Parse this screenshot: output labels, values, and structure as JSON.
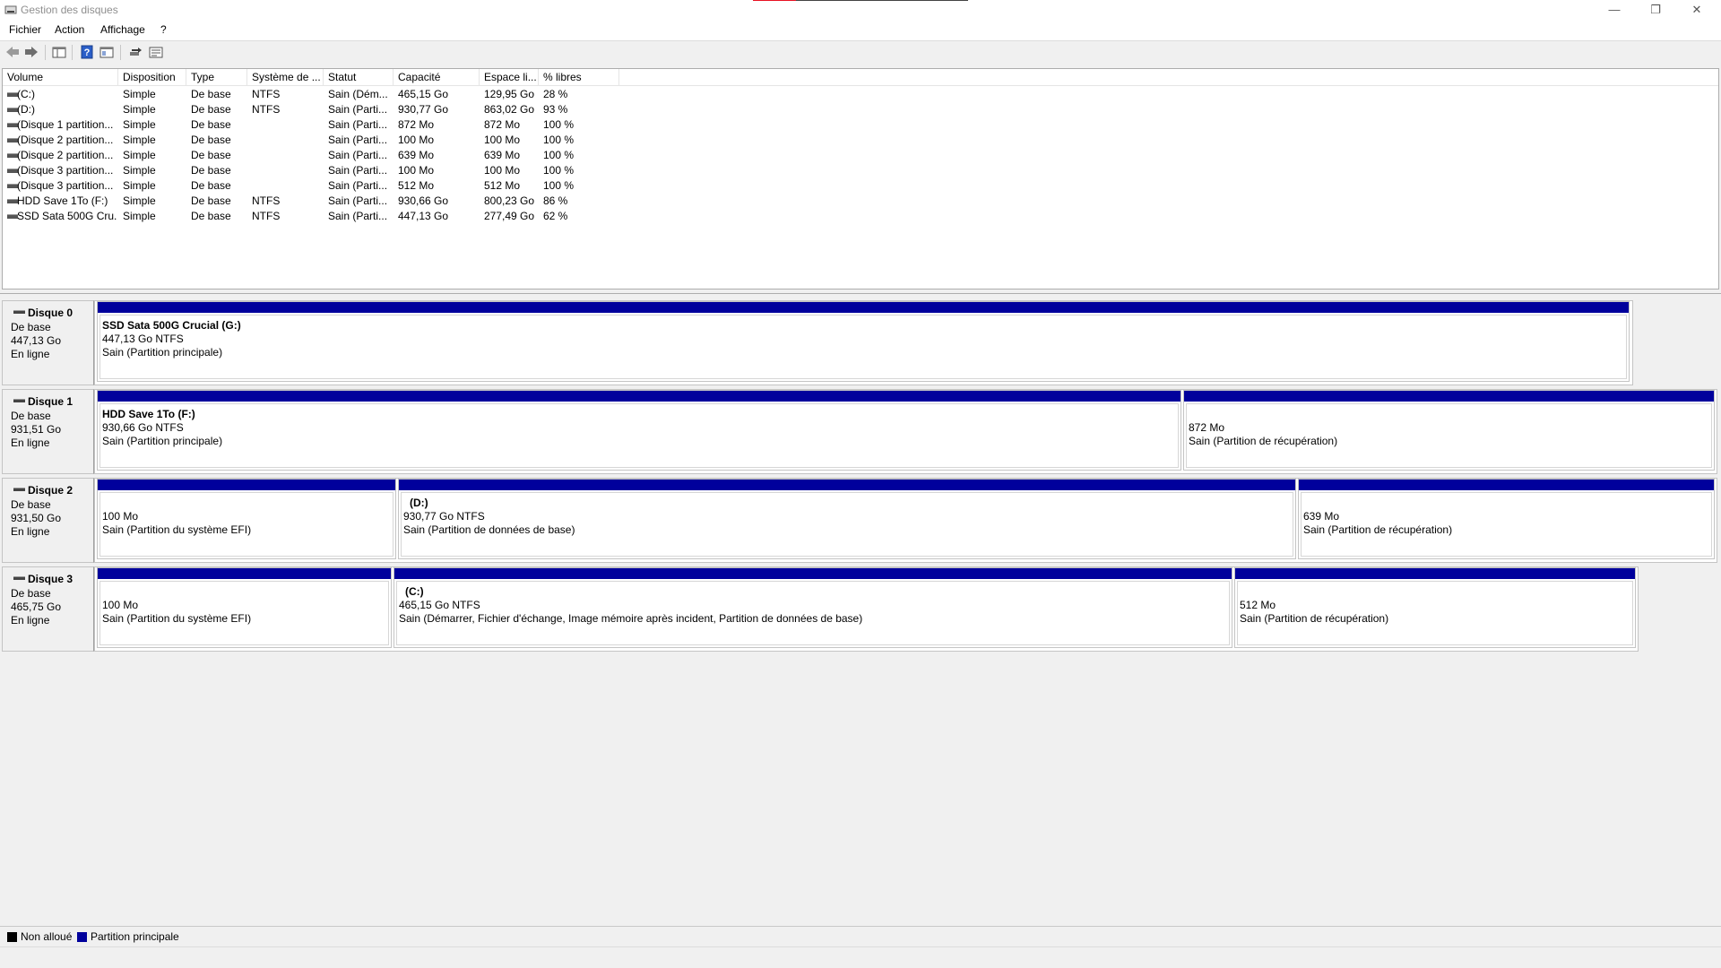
{
  "window": {
    "title": "Gestion des disques",
    "minimize": "—",
    "restore": "❐",
    "close": "✕"
  },
  "menu": [
    "Fichier",
    "Action",
    "Affichage",
    "?"
  ],
  "toolbar": [
    "back-arrow-icon",
    "forward-arrow-icon",
    "console-tree-icon",
    "help-icon",
    "properties-icon",
    "refresh-icon",
    "settings-icon"
  ],
  "volume_list": {
    "columns": [
      "Volume",
      "Disposition",
      "Type",
      "Système de ...",
      "Statut",
      "Capacité",
      "Espace li...",
      "% libres"
    ],
    "rows": [
      [
        "(C:)",
        "Simple",
        "De base",
        "NTFS",
        "Sain (Dém...",
        "465,15 Go",
        "129,95 Go",
        "28 %"
      ],
      [
        "(D:)",
        "Simple",
        "De base",
        "NTFS",
        "Sain (Parti...",
        "930,77 Go",
        "863,02 Go",
        "93 %"
      ],
      [
        "(Disque 1 partition...",
        "Simple",
        "De base",
        "",
        "Sain (Parti...",
        "872 Mo",
        "872 Mo",
        "100 %"
      ],
      [
        "(Disque 2 partition...",
        "Simple",
        "De base",
        "",
        "Sain (Parti...",
        "100 Mo",
        "100 Mo",
        "100 %"
      ],
      [
        "(Disque 2 partition...",
        "Simple",
        "De base",
        "",
        "Sain (Parti...",
        "639 Mo",
        "639 Mo",
        "100 %"
      ],
      [
        "(Disque 3 partition...",
        "Simple",
        "De base",
        "",
        "Sain (Parti...",
        "100 Mo",
        "100 Mo",
        "100 %"
      ],
      [
        "(Disque 3 partition...",
        "Simple",
        "De base",
        "",
        "Sain (Parti...",
        "512 Mo",
        "512 Mo",
        "100 %"
      ],
      [
        "HDD Save 1To (F:)",
        "Simple",
        "De base",
        "NTFS",
        "Sain (Parti...",
        "930,66 Go",
        "800,23 Go",
        "86 %"
      ],
      [
        "SSD Sata 500G Cru...",
        "Simple",
        "De base",
        "NTFS",
        "Sain (Parti...",
        "447,13 Go",
        "277,49 Go",
        "62 %"
      ]
    ]
  },
  "disks": [
    {
      "name": "Disque 0",
      "type": "De base",
      "size": "447,13 Go",
      "state": "En ligne",
      "partitions": [
        {
          "title": "SSD Sata 500G Crucial  (G:)",
          "size": "447,13 Go NTFS",
          "status": "Sain (Partition principale)"
        }
      ]
    },
    {
      "name": "Disque 1",
      "type": "De base",
      "size": "931,51 Go",
      "state": "En ligne",
      "partitions": [
        {
          "title": "HDD Save 1To  (F:)",
          "size": "930,66 Go NTFS",
          "status": "Sain (Partition principale)"
        },
        {
          "title": "",
          "size": "872 Mo",
          "status": "Sain (Partition de récupération)"
        }
      ]
    },
    {
      "name": "Disque 2",
      "type": "De base",
      "size": "931,50 Go",
      "state": "En ligne",
      "partitions": [
        {
          "title": "",
          "size": "100 Mo",
          "status": "Sain (Partition du système EFI)"
        },
        {
          "title": "(D:)",
          "size": "930,77 Go NTFS",
          "status": "Sain (Partition de données de base)"
        },
        {
          "title": "",
          "size": "639 Mo",
          "status": "Sain (Partition de récupération)"
        }
      ]
    },
    {
      "name": "Disque 3",
      "type": "De base",
      "size": "465,75 Go",
      "state": "En ligne",
      "partitions": [
        {
          "title": "",
          "size": "100 Mo",
          "status": "Sain (Partition du système EFI)"
        },
        {
          "title": "(C:)",
          "size": "465,15 Go NTFS",
          "status": "Sain (Démarrer, Fichier d'échange, Image mémoire après incident, Partition de données de base)"
        },
        {
          "title": "",
          "size": "512 Mo",
          "status": "Sain (Partition de récupération)"
        }
      ]
    }
  ],
  "legend": [
    {
      "label": "Non alloué",
      "color": "#000000"
    },
    {
      "label": "Partition principale",
      "color": "#00009c"
    }
  ],
  "colors": {
    "partition_bar": "#00009c"
  }
}
